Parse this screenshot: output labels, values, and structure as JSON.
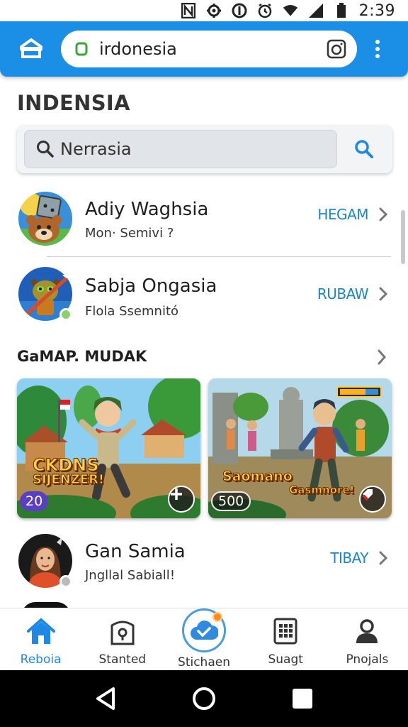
{
  "status_bar": {
    "time": "2:39",
    "icons": [
      "n-notification-icon",
      "settings-notification-icon",
      "sync-notification-icon",
      "alarm-icon",
      "wifi-icon",
      "signal-icon",
      "battery-icon"
    ]
  },
  "browser": {
    "url": "irdonesia",
    "icons": [
      "home-icon",
      "lock-icon",
      "camera-icon",
      "more-vert-icon"
    ]
  },
  "page": {
    "title": "INDENSIA",
    "search": {
      "value": "Nerrasia",
      "icon": "search-icon"
    }
  },
  "list_top": [
    {
      "name": "Adiy Waghsia",
      "subtitle": "Mon· Semivi ?",
      "action": "HEGAM",
      "avatar": "bear-dice-avatar",
      "online": false
    },
    {
      "name": "Sabja Ongasia",
      "subtitle": "Flola Ssemnitό",
      "action": "RUBAW",
      "avatar": "cat-warrior-avatar",
      "online": true
    }
  ],
  "section": {
    "title": "GaMAP. MUDAK"
  },
  "cards": [
    {
      "title_line1": "CKDNS",
      "title_line2": "SIJENZER!",
      "badge": "20",
      "button_icon": "plus-icon"
    },
    {
      "title_line1": "Saomano",
      "title_line2": "Gasmnore!",
      "badge": "500",
      "button_icon": "tag-icon"
    }
  ],
  "list_bottom": [
    {
      "name": "Gan Samia",
      "subtitle": "Jngllal Sabiall!",
      "action": "TIBAY",
      "avatar": "woman-avatar",
      "online": true
    }
  ],
  "bottom_nav": [
    {
      "label": "Reboia",
      "icon": "home-icon",
      "active": true
    },
    {
      "label": "Stanted",
      "icon": "lock-book-icon",
      "active": false
    },
    {
      "label": "Stichaen",
      "icon": "cloud-check-icon",
      "active": false
    },
    {
      "label": "Suagt",
      "icon": "grid-icon",
      "active": false
    },
    {
      "label": "Pnojals",
      "icon": "person-icon",
      "active": false
    }
  ],
  "colors": {
    "primary": "#1b8fe6",
    "action_text": "#1a86c8",
    "active_nav": "#1e88e5",
    "card_title": "#ffd23c",
    "badge_purple": "#5a3fc0"
  }
}
